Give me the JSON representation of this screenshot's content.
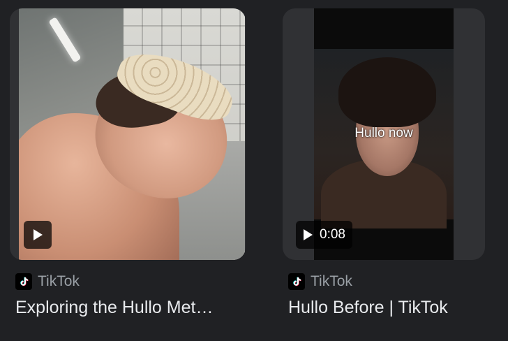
{
  "results": [
    {
      "source": "TikTok",
      "title": "Exploring the Hullo Met…",
      "overlay_text": "",
      "duration": ""
    },
    {
      "source": "TikTok",
      "title": "Hullo Before | TikTok",
      "overlay_text": "Hullo now",
      "duration": "0:08"
    }
  ],
  "icons": {
    "source_icon": "tiktok-icon",
    "play_icon": "play-icon"
  },
  "colors": {
    "background": "#202124",
    "card": "#303134",
    "source_text": "#9aa0a6",
    "title_text": "#e8eaed"
  }
}
